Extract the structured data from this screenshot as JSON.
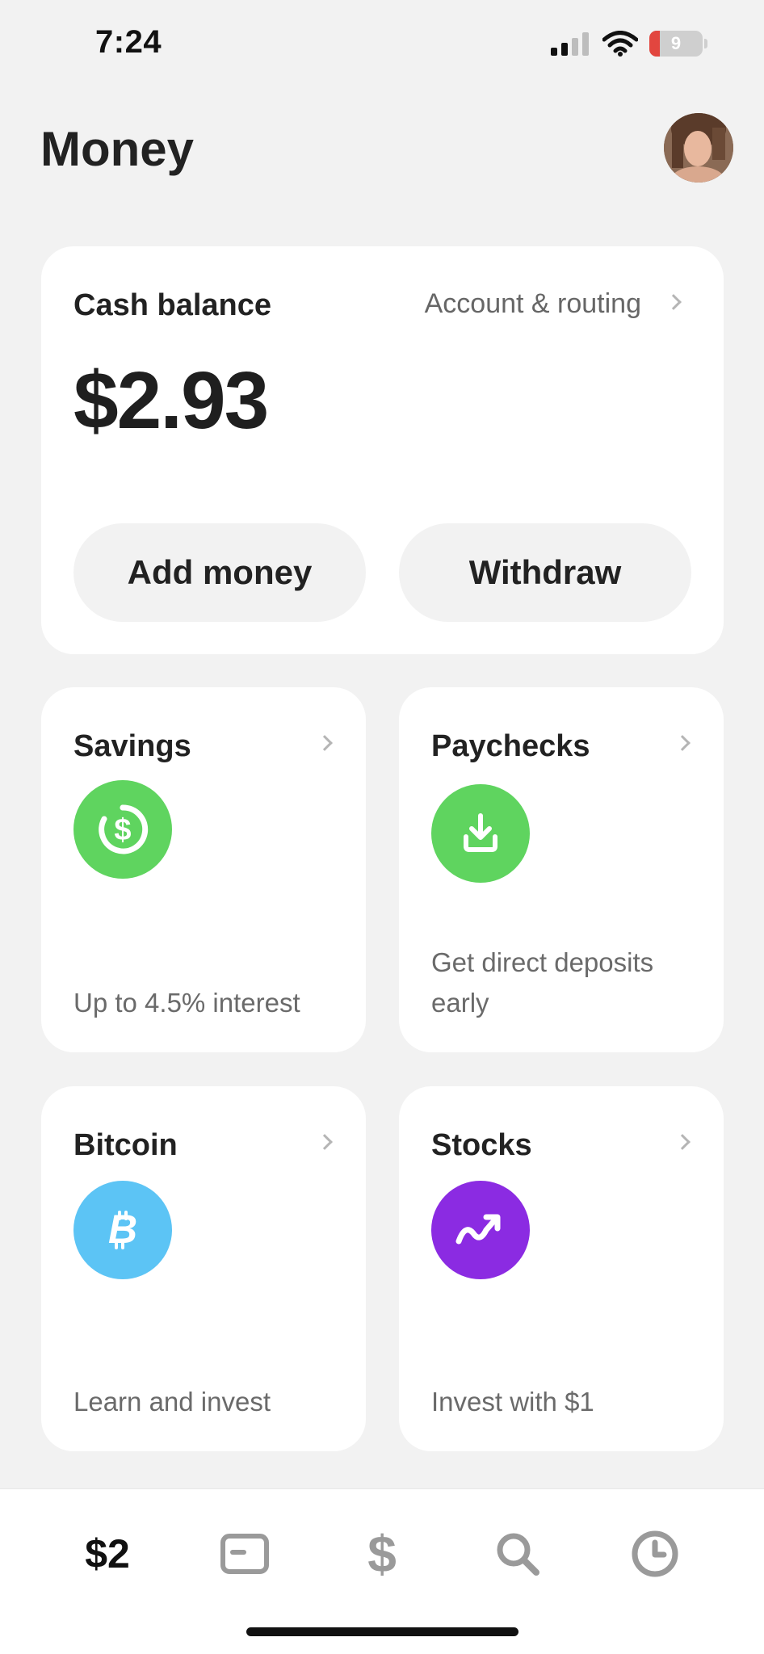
{
  "status": {
    "time": "7:24",
    "battery_level": "9",
    "battery_fraction": 0.09,
    "icons": [
      "cellular-signal-icon",
      "wifi-icon",
      "battery-icon"
    ]
  },
  "header": {
    "title": "Money",
    "avatar": "profile-photo"
  },
  "balance": {
    "title": "Cash balance",
    "link": "Account & routing",
    "amount": "$2.93",
    "add_label": "Add money",
    "withdraw_label": "Withdraw"
  },
  "tiles": [
    {
      "title": "Savings",
      "desc": "Up to 4.5% interest",
      "icon": "savings-dollar-icon",
      "color": "#5fd45f"
    },
    {
      "title": "Paychecks",
      "desc": "Get direct deposits early",
      "icon": "download-icon",
      "color": "#5fd45f"
    },
    {
      "title": "Bitcoin",
      "desc": "Learn and invest",
      "icon": "bitcoin-icon",
      "color": "#5cc4f5"
    },
    {
      "title": "Stocks",
      "desc": "Invest with $1",
      "icon": "trend-up-icon",
      "color": "#8b2be2"
    }
  ],
  "tabbar": {
    "balance_label": "$2",
    "items": [
      "balance-tab",
      "card-icon",
      "dollar-icon",
      "search-icon",
      "activity-clock-icon"
    ]
  },
  "colors": {
    "background": "#f2f2f2",
    "card": "#ffffff",
    "pill": "#f2f2f2",
    "text": "#1f1f1f",
    "muted": "#6a6a6a",
    "tab_icon": "#9a9a9a"
  }
}
